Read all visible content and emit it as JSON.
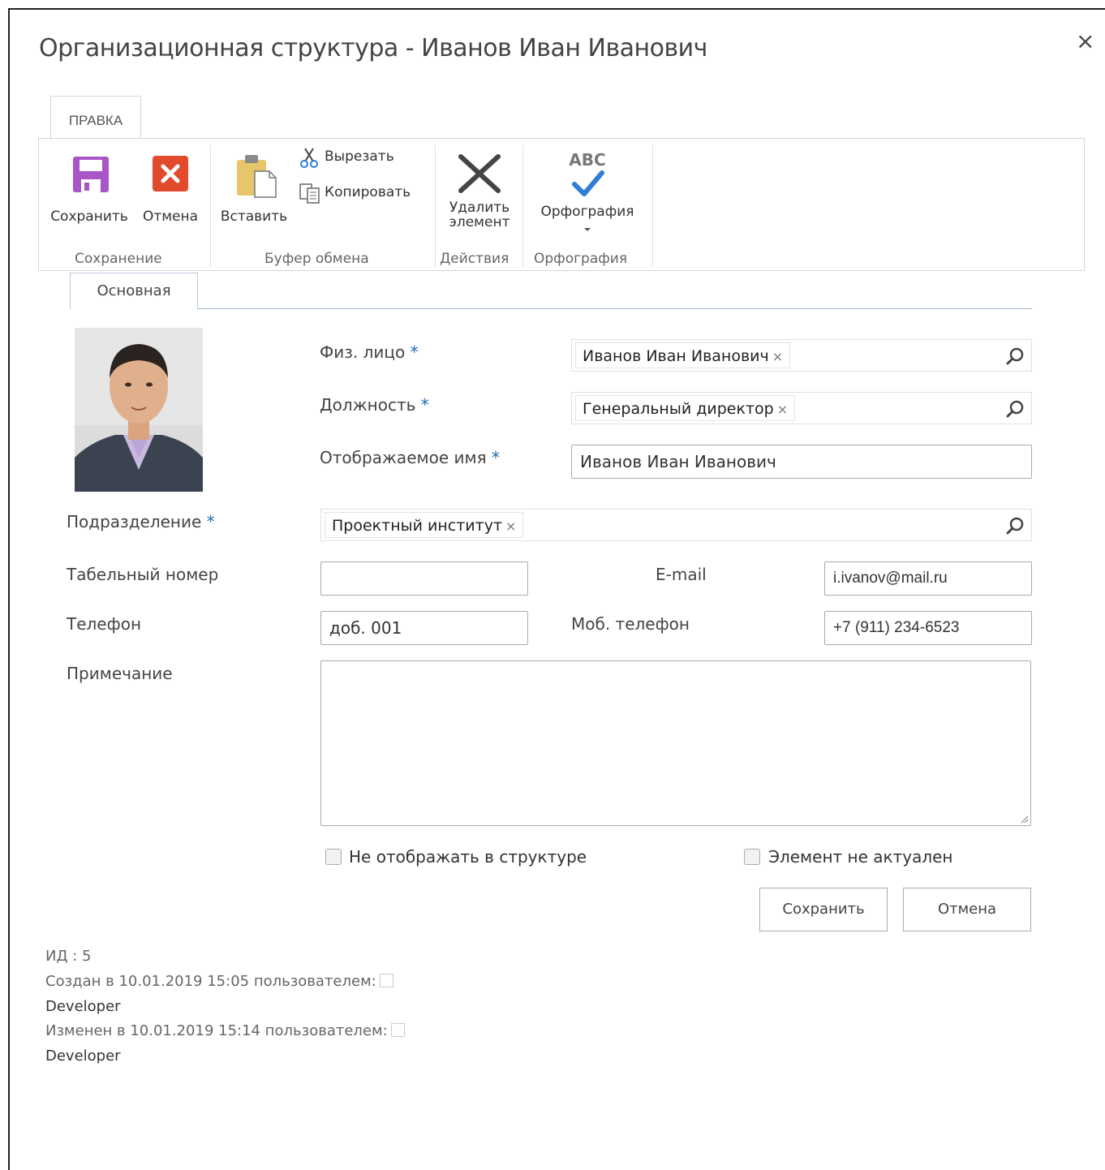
{
  "dialog": {
    "title": "Организационная структура - Иванов Иван Иванович",
    "close_label": "×"
  },
  "ribbon": {
    "tab_label": "ПРАВКА",
    "save_label": "Сохранить",
    "cancel_label": "Отмена",
    "paste_label": "Вставить",
    "cut_label": "Вырезать",
    "copy_label": "Копировать",
    "delete_label_1": "Удалить",
    "delete_label_2": "элемент",
    "spelling_label": "Орфография",
    "spelling_icon_text": "ABC",
    "groups": {
      "save": "Сохранение",
      "clipboard": "Буфер обмена",
      "actions": "Действия",
      "spelling": "Орфография"
    }
  },
  "tabs": {
    "main": "Основная"
  },
  "form": {
    "person_label": "Физ. лицо",
    "person_value": "Иванов Иван Иванович",
    "position_label": "Должность",
    "position_value": "Генеральный директор",
    "display_name_label": "Отображаемое имя",
    "display_name_value": "Иванов Иван Иванович",
    "department_label": "Подразделение",
    "department_value": "Проектный институт",
    "personnel_number_label": "Табельный номер",
    "personnel_number_value": "",
    "email_label": "E-mail",
    "email_value": "i.ivanov@mail.ru",
    "phone_label": "Телефон",
    "phone_value": "доб. 001",
    "mobile_label": "Моб. телефон",
    "mobile_value": "+7 (911) 234-6523",
    "note_label": "Примечание",
    "note_value": "",
    "required_mark": "*",
    "remove_mark": "×",
    "hide_checkbox_label": "Не отображать в структуре",
    "inactive_checkbox_label": "Элемент не актуален",
    "save_button": "Сохранить",
    "cancel_button": "Отмена"
  },
  "meta": {
    "id_line": "ИД : 5",
    "created_line": "Создан в 10.01.2019 15:05  пользователем:",
    "created_by": "Developer",
    "modified_line": "Изменен в 10.01.2019 15:14  пользователем:",
    "modified_by": "Developer"
  },
  "colors": {
    "required": "#1f6ab0",
    "save_icon": "#a855c8",
    "cancel_icon": "#e14a2a",
    "check": "#2f7ed8"
  }
}
